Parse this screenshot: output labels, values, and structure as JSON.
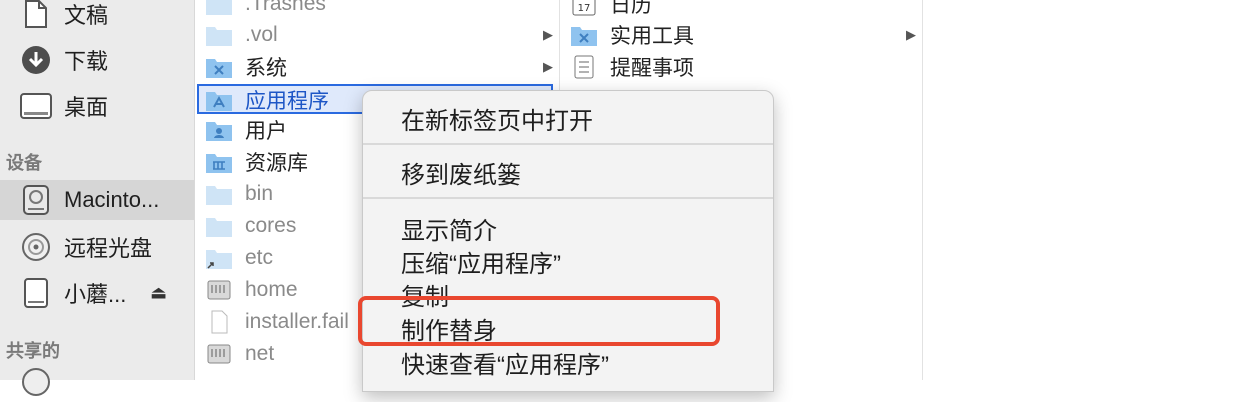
{
  "sidebar": {
    "items": [
      {
        "label": "文稿",
        "icon": "document-icon"
      },
      {
        "label": "下载",
        "icon": "download-icon"
      },
      {
        "label": "桌面",
        "icon": "desktop-icon"
      }
    ],
    "devices_heading": "设备",
    "devices": [
      {
        "label": "Macinto...",
        "icon": "hard-disk-icon",
        "selected": true
      },
      {
        "label": "远程光盘",
        "icon": "optical-disc-icon"
      },
      {
        "label": "小蘑...",
        "icon": "external-drive-icon",
        "eject": "⏏"
      }
    ],
    "shared_heading": "共享的"
  },
  "column1": {
    "rows": [
      {
        "name": ".Trashes",
        "grey": true
      },
      {
        "name": ".vol",
        "grey": true,
        "arrow": true
      },
      {
        "name": "系统",
        "arrow": true
      },
      {
        "name": "应用程序",
        "selected": true,
        "arrow": true
      },
      {
        "name": "用户"
      },
      {
        "name": "资源库"
      },
      {
        "name": "bin",
        "grey": true
      },
      {
        "name": "cores",
        "grey": true
      },
      {
        "name": "etc",
        "grey": true
      },
      {
        "name": "home",
        "grey": true
      },
      {
        "name": "installer.fail",
        "grey": true
      },
      {
        "name": "net",
        "grey": true
      }
    ]
  },
  "column2": {
    "rows": [
      {
        "name": "日历"
      },
      {
        "name": "实用工具",
        "arrow": true
      },
      {
        "name": "提醒事项"
      }
    ]
  },
  "context_menu": {
    "open_in_new_tab": "在新标签页中打开",
    "move_to_trash": "移到废纸篓",
    "get_info": "显示简介",
    "compress": "压缩“应用程序”",
    "duplicate": "复制",
    "make_alias": "制作替身",
    "quick_look": "快速查看“应用程序”"
  },
  "colors": {
    "highlight_outline": "#e9472f",
    "selection_border": "#2a6ae0",
    "folder_blue": "#8fc3ef"
  }
}
